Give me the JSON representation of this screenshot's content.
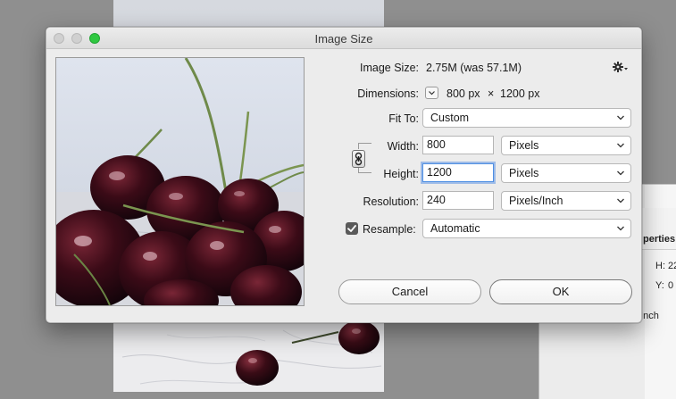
{
  "dialog": {
    "title": "Image Size",
    "image_size_label": "Image Size:",
    "image_size_value": "2.75M (was 57.1M)",
    "dimensions_label": "Dimensions:",
    "dimensions_width": "800 px",
    "dimensions_times": "×",
    "dimensions_height": "1200 px",
    "fit_to_label": "Fit To:",
    "fit_to_value": "Custom",
    "width_label": "Width:",
    "width_value": "800",
    "width_unit": "Pixels",
    "height_label": "Height:",
    "height_value": "1200",
    "height_unit": "Pixels",
    "resolution_label": "Resolution:",
    "resolution_value": "240",
    "resolution_unit": "Pixels/Inch",
    "resample_label": "Resample:",
    "resample_checked": true,
    "resample_value": "Automatic",
    "cancel_label": "Cancel",
    "ok_label": "OK"
  },
  "background_panel": {
    "title_fragment": "perties",
    "h_label": "H:",
    "h_value_fragment": "22",
    "y_label": "Y:",
    "y_value": "0",
    "unit_fragment": "/Inch"
  },
  "colors": {
    "focus_ring": "#4f8fe3",
    "zoom_button": "#2fc841",
    "checkbox": "#5a5a5a"
  },
  "icons": [
    "gear-icon",
    "chevron-down-icon",
    "link-constrain-icon",
    "checkmark-icon"
  ]
}
